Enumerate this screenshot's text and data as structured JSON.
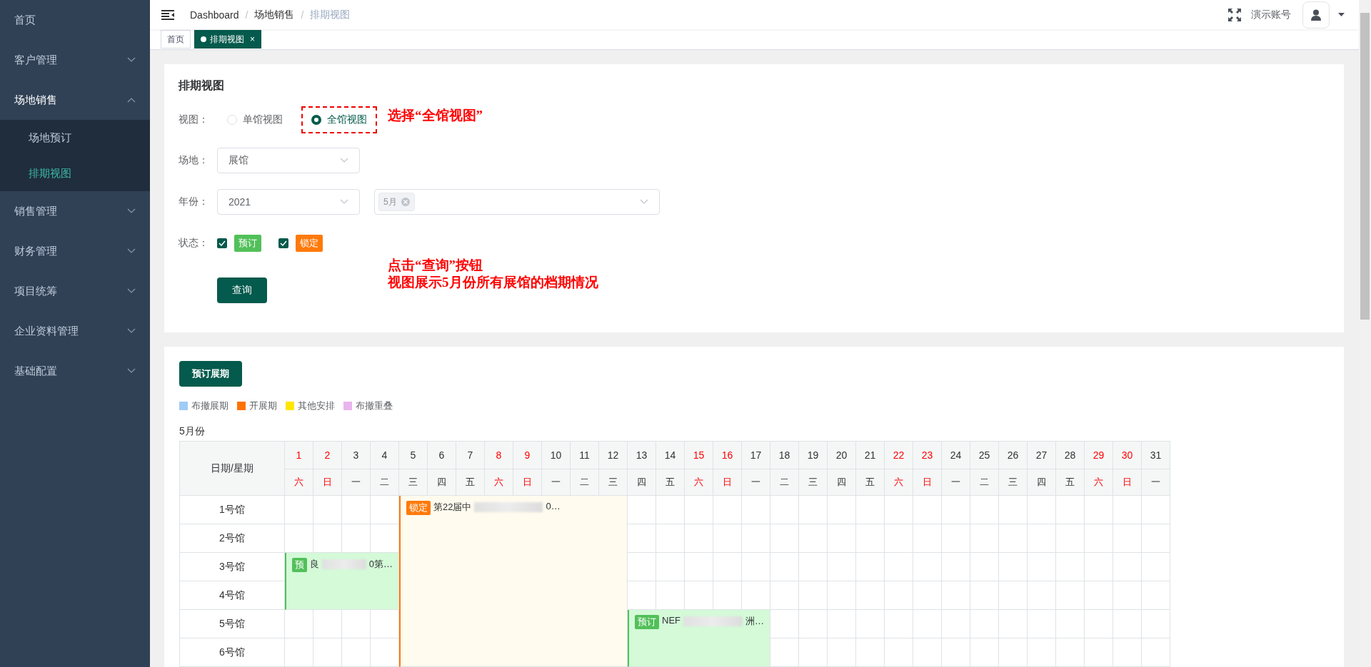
{
  "sidebar": {
    "items": [
      {
        "label": "首页",
        "kind": "link",
        "selected": false
      },
      {
        "label": "客户管理",
        "kind": "group",
        "selected": false,
        "expanded": false
      },
      {
        "label": "场地销售",
        "kind": "group",
        "selected": false,
        "expanded": true,
        "children": [
          {
            "label": "场地预订",
            "selected": false
          },
          {
            "label": "排期视图",
            "selected": true
          }
        ]
      },
      {
        "label": "销售管理",
        "kind": "group",
        "selected": false,
        "expanded": false
      },
      {
        "label": "财务管理",
        "kind": "group",
        "selected": false,
        "expanded": false
      },
      {
        "label": "项目统筹",
        "kind": "group",
        "selected": false,
        "expanded": false
      },
      {
        "label": "企业资料管理",
        "kind": "group",
        "selected": false,
        "expanded": false
      },
      {
        "label": "基础配置",
        "kind": "group",
        "selected": false,
        "expanded": false
      }
    ]
  },
  "header": {
    "breadcrumb": [
      "Dashboard",
      "场地销售",
      "排期视图"
    ],
    "separator": "/",
    "user": "演示账号"
  },
  "tabs": [
    {
      "label": "首页",
      "selected": false
    },
    {
      "label": "排期视图",
      "selected": true,
      "close": "×"
    }
  ],
  "filter": {
    "title": "排期视图",
    "view": {
      "label": "视图：",
      "options": [
        {
          "label": "单馆视图",
          "selected": false,
          "highlighted": false
        },
        {
          "label": "全馆视图",
          "selected": true,
          "highlighted": true
        }
      ]
    },
    "venue": {
      "label": "场地：",
      "value": "展馆"
    },
    "year": {
      "label": "年份：",
      "value": "2021",
      "months": [
        "5月"
      ]
    },
    "status": {
      "label": "状态：",
      "options": [
        {
          "label": "预订",
          "checked": true,
          "color": "#52c05a"
        },
        {
          "label": "锁定",
          "checked": true,
          "color": "#ff7a0a"
        }
      ]
    },
    "button": "查询",
    "annotations": [
      {
        "lines": [
          "选择“全馆视图”"
        ]
      },
      {
        "lines": [
          "点击“查询”按钮",
          "视图展示5月份所有展馆的档期情况"
        ]
      }
    ]
  },
  "schedule": {
    "button": "预订展期",
    "legend": [
      {
        "label": "布撤展期",
        "color": "#9fcbf7"
      },
      {
        "label": "开展期",
        "color": "#ff7300"
      },
      {
        "label": "其他安排",
        "color": "#ffe600"
      },
      {
        "label": "布撤重叠",
        "color": "#e9b5ee"
      }
    ],
    "month": "5月份",
    "corner": "日期/星期",
    "days": [
      {
        "date": "1",
        "weekday": "六",
        "weekend": true
      },
      {
        "date": "2",
        "weekday": "日",
        "weekend": true
      },
      {
        "date": "3",
        "weekday": "一",
        "weekend": false
      },
      {
        "date": "4",
        "weekday": "二",
        "weekend": false
      },
      {
        "date": "5",
        "weekday": "三",
        "weekend": false
      },
      {
        "date": "6",
        "weekday": "四",
        "weekend": false
      },
      {
        "date": "7",
        "weekday": "五",
        "weekend": false
      },
      {
        "date": "8",
        "weekday": "六",
        "weekend": true
      },
      {
        "date": "9",
        "weekday": "日",
        "weekend": true
      },
      {
        "date": "10",
        "weekday": "一",
        "weekend": false
      },
      {
        "date": "11",
        "weekday": "二",
        "weekend": false
      },
      {
        "date": "12",
        "weekday": "三",
        "weekend": false
      },
      {
        "date": "13",
        "weekday": "四",
        "weekend": false
      },
      {
        "date": "14",
        "weekday": "五",
        "weekend": false
      },
      {
        "date": "15",
        "weekday": "六",
        "weekend": true
      },
      {
        "date": "16",
        "weekday": "日",
        "weekend": true
      },
      {
        "date": "17",
        "weekday": "一",
        "weekend": false
      },
      {
        "date": "18",
        "weekday": "二",
        "weekend": false
      },
      {
        "date": "19",
        "weekday": "三",
        "weekend": false
      },
      {
        "date": "20",
        "weekday": "四",
        "weekend": false
      },
      {
        "date": "21",
        "weekday": "五",
        "weekend": false
      },
      {
        "date": "22",
        "weekday": "六",
        "weekend": true
      },
      {
        "date": "23",
        "weekday": "日",
        "weekend": true
      },
      {
        "date": "24",
        "weekday": "一",
        "weekend": false
      },
      {
        "date": "25",
        "weekday": "二",
        "weekend": false
      },
      {
        "date": "26",
        "weekday": "三",
        "weekend": false
      },
      {
        "date": "27",
        "weekday": "四",
        "weekend": false
      },
      {
        "date": "28",
        "weekday": "五",
        "weekend": false
      },
      {
        "date": "29",
        "weekday": "六",
        "weekend": true
      },
      {
        "date": "30",
        "weekday": "日",
        "weekend": true
      },
      {
        "date": "31",
        "weekday": "一",
        "weekend": false
      }
    ],
    "halls": [
      {
        "name": "1号馆",
        "cells": [
          {
            "kind": "free"
          },
          {
            "kind": "free"
          },
          {
            "kind": "free"
          },
          {
            "kind": "free"
          },
          {
            "kind": "locked",
            "badge": "锁定",
            "title_start": "第22届中",
            "title_end": "0…"
          },
          {
            "kind": "covered"
          },
          {
            "kind": "covered"
          },
          {
            "kind": "covered"
          },
          {
            "kind": "covered"
          },
          {
            "kind": "covered"
          },
          {
            "kind": "covered"
          },
          {
            "kind": "covered"
          },
          {
            "kind": "free"
          },
          {
            "kind": "free"
          },
          {
            "kind": "free"
          },
          {
            "kind": "free"
          },
          {
            "kind": "free"
          },
          {
            "kind": "free"
          },
          {
            "kind": "free"
          },
          {
            "kind": "free"
          },
          {
            "kind": "free"
          },
          {
            "kind": "free"
          },
          {
            "kind": "free"
          },
          {
            "kind": "free"
          },
          {
            "kind": "free"
          },
          {
            "kind": "free"
          },
          {
            "kind": "free"
          },
          {
            "kind": "free"
          },
          {
            "kind": "free"
          },
          {
            "kind": "free"
          },
          {
            "kind": "free"
          }
        ]
      },
      {
        "name": "2号馆",
        "cells": [
          {
            "kind": "free"
          },
          {
            "kind": "free"
          },
          {
            "kind": "free"
          },
          {
            "kind": "free"
          },
          {
            "kind": "covered"
          },
          {
            "kind": "covered"
          },
          {
            "kind": "covered"
          },
          {
            "kind": "covered"
          },
          {
            "kind": "covered"
          },
          {
            "kind": "covered"
          },
          {
            "kind": "covered"
          },
          {
            "kind": "covered"
          },
          {
            "kind": "free"
          },
          {
            "kind": "free"
          },
          {
            "kind": "free"
          },
          {
            "kind": "free"
          },
          {
            "kind": "free"
          },
          {
            "kind": "free"
          },
          {
            "kind": "free"
          },
          {
            "kind": "free"
          },
          {
            "kind": "free"
          },
          {
            "kind": "free"
          },
          {
            "kind": "free"
          },
          {
            "kind": "free"
          },
          {
            "kind": "free"
          },
          {
            "kind": "free"
          },
          {
            "kind": "free"
          },
          {
            "kind": "free"
          },
          {
            "kind": "free"
          },
          {
            "kind": "free"
          },
          {
            "kind": "free"
          }
        ]
      },
      {
        "name": "3号馆",
        "cells": [
          {
            "kind": "reserved",
            "badge": "预",
            "title_start": "良",
            "title_end": "0第…"
          },
          {
            "kind": "covered"
          },
          {
            "kind": "covered"
          },
          {
            "kind": "covered"
          },
          {
            "kind": "covered"
          },
          {
            "kind": "covered"
          },
          {
            "kind": "covered"
          },
          {
            "kind": "covered"
          },
          {
            "kind": "covered"
          },
          {
            "kind": "covered"
          },
          {
            "kind": "covered"
          },
          {
            "kind": "covered"
          },
          {
            "kind": "free"
          },
          {
            "kind": "free"
          },
          {
            "kind": "free"
          },
          {
            "kind": "free"
          },
          {
            "kind": "free"
          },
          {
            "kind": "free"
          },
          {
            "kind": "free"
          },
          {
            "kind": "free"
          },
          {
            "kind": "free"
          },
          {
            "kind": "free"
          },
          {
            "kind": "free"
          },
          {
            "kind": "free"
          },
          {
            "kind": "free"
          },
          {
            "kind": "free"
          },
          {
            "kind": "free"
          },
          {
            "kind": "free"
          },
          {
            "kind": "free"
          },
          {
            "kind": "free"
          },
          {
            "kind": "free"
          }
        ]
      },
      {
        "name": "4号馆",
        "cells": [
          {
            "kind": "covered"
          },
          {
            "kind": "covered"
          },
          {
            "kind": "covered"
          },
          {
            "kind": "covered"
          },
          {
            "kind": "covered"
          },
          {
            "kind": "covered"
          },
          {
            "kind": "covered"
          },
          {
            "kind": "covered"
          },
          {
            "kind": "covered"
          },
          {
            "kind": "covered"
          },
          {
            "kind": "covered"
          },
          {
            "kind": "covered"
          },
          {
            "kind": "free"
          },
          {
            "kind": "free"
          },
          {
            "kind": "free"
          },
          {
            "kind": "free"
          },
          {
            "kind": "free"
          },
          {
            "kind": "free"
          },
          {
            "kind": "free"
          },
          {
            "kind": "free"
          },
          {
            "kind": "free"
          },
          {
            "kind": "free"
          },
          {
            "kind": "free"
          },
          {
            "kind": "free"
          },
          {
            "kind": "free"
          },
          {
            "kind": "free"
          },
          {
            "kind": "free"
          },
          {
            "kind": "free"
          },
          {
            "kind": "free"
          },
          {
            "kind": "free"
          },
          {
            "kind": "free"
          }
        ]
      },
      {
        "name": "5号馆",
        "cells": [
          {
            "kind": "free"
          },
          {
            "kind": "free"
          },
          {
            "kind": "free"
          },
          {
            "kind": "free"
          },
          {
            "kind": "covered"
          },
          {
            "kind": "covered"
          },
          {
            "kind": "covered"
          },
          {
            "kind": "covered"
          },
          {
            "kind": "covered"
          },
          {
            "kind": "covered"
          },
          {
            "kind": "covered"
          },
          {
            "kind": "covered"
          },
          {
            "kind": "reserved",
            "badge": "预订",
            "title_start": "NEF",
            "title_end": "洲…"
          },
          {
            "kind": "covered"
          },
          {
            "kind": "covered"
          },
          {
            "kind": "covered"
          },
          {
            "kind": "covered"
          },
          {
            "kind": "free"
          },
          {
            "kind": "free"
          },
          {
            "kind": "free"
          },
          {
            "kind": "free"
          },
          {
            "kind": "free"
          },
          {
            "kind": "free"
          },
          {
            "kind": "free"
          },
          {
            "kind": "free"
          },
          {
            "kind": "free"
          },
          {
            "kind": "free"
          },
          {
            "kind": "free"
          },
          {
            "kind": "free"
          },
          {
            "kind": "free"
          },
          {
            "kind": "free"
          }
        ]
      },
      {
        "name": "6号馆",
        "cells": [
          {
            "kind": "free"
          },
          {
            "kind": "free"
          },
          {
            "kind": "free"
          },
          {
            "kind": "free"
          },
          {
            "kind": "covered"
          },
          {
            "kind": "covered"
          },
          {
            "kind": "covered"
          },
          {
            "kind": "covered"
          },
          {
            "kind": "covered"
          },
          {
            "kind": "covered"
          },
          {
            "kind": "covered"
          },
          {
            "kind": "covered"
          },
          {
            "kind": "covered"
          },
          {
            "kind": "covered"
          },
          {
            "kind": "covered"
          },
          {
            "kind": "covered"
          },
          {
            "kind": "covered"
          },
          {
            "kind": "free"
          },
          {
            "kind": "free"
          },
          {
            "kind": "free"
          },
          {
            "kind": "free"
          },
          {
            "kind": "free"
          },
          {
            "kind": "free"
          },
          {
            "kind": "free"
          },
          {
            "kind": "free"
          },
          {
            "kind": "free"
          },
          {
            "kind": "free"
          },
          {
            "kind": "free"
          },
          {
            "kind": "free"
          },
          {
            "kind": "free"
          },
          {
            "kind": "free"
          }
        ]
      }
    ]
  }
}
